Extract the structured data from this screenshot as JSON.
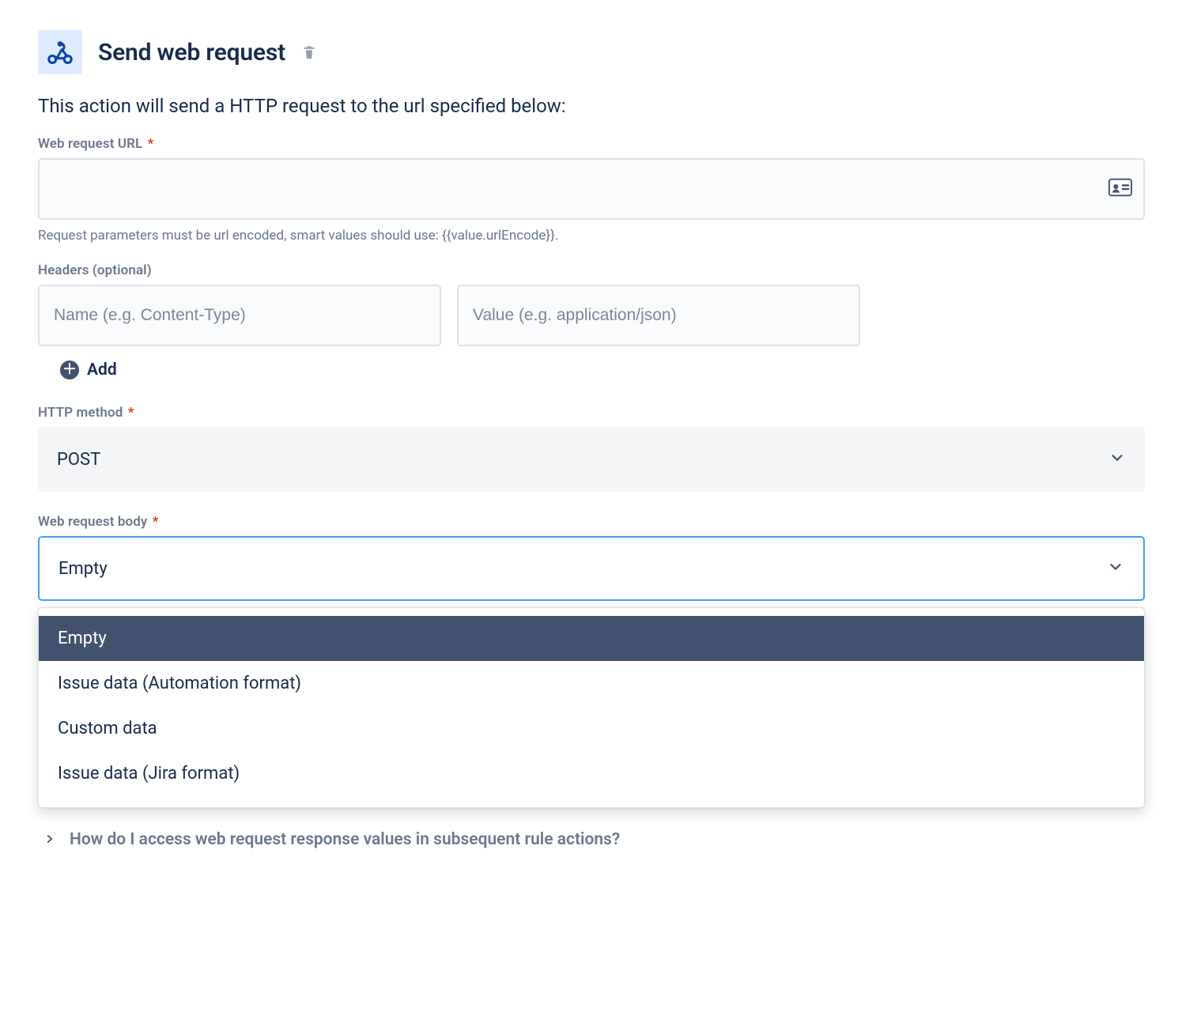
{
  "header": {
    "title": "Send web request"
  },
  "description": "This action will send a HTTP request to the url specified below:",
  "url_field": {
    "label": "Web request URL",
    "required": "*",
    "value": "",
    "helper": "Request parameters must be url encoded, smart values should use: {{value.urlEncode}}."
  },
  "headers": {
    "label": "Headers (optional)",
    "name_placeholder": "Name (e.g. Content-Type)",
    "value_placeholder": "Value (e.g. application/json)",
    "add_label": "Add"
  },
  "method": {
    "label": "HTTP method",
    "required": "*",
    "value": "POST"
  },
  "body": {
    "label": "Web request body",
    "required": "*",
    "value": "Empty",
    "options": [
      "Empty",
      "Issue data (Automation format)",
      "Custom data",
      "Issue data (Jira format)"
    ]
  },
  "expand": {
    "title": "How do I access web request response values in subsequent rule actions?"
  }
}
